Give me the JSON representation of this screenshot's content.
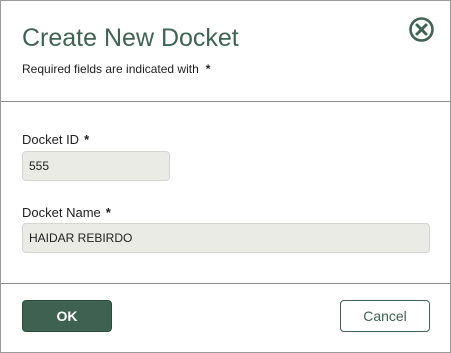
{
  "dialog": {
    "title": "Create New Docket",
    "required_note": "Required fields are indicated with",
    "required_marker": "*",
    "close_icon": "close-circle-icon",
    "accent_color": "#3e6152",
    "title_color": "#3f6354"
  },
  "fields": {
    "docket_id": {
      "label": "Docket ID",
      "required_marker": "*",
      "value": "555"
    },
    "docket_name": {
      "label": "Docket Name",
      "required_marker": "*",
      "value": "HAIDAR REBIRDO"
    }
  },
  "buttons": {
    "ok_label": "OK",
    "cancel_label": "Cancel"
  }
}
